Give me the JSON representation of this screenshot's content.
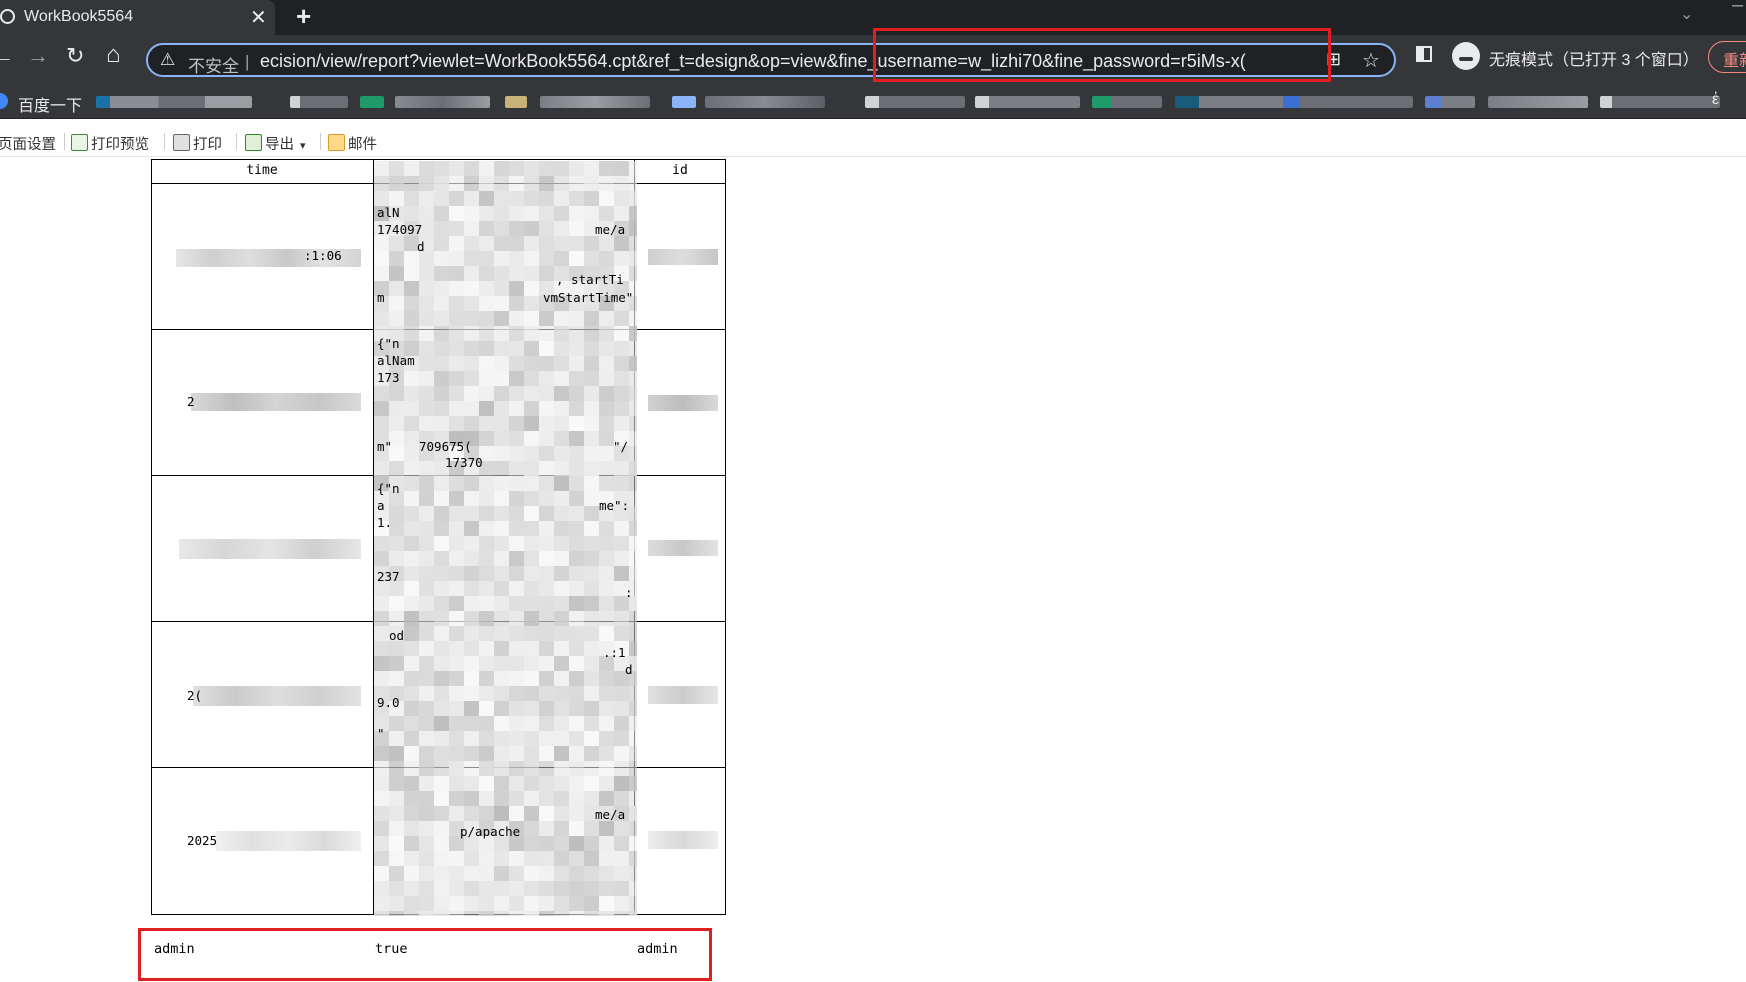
{
  "browser": {
    "tab_title": "WorkBook5564",
    "tab_close_glyph": "✕",
    "new_tab_glyph": "+",
    "tab_menu_glyph": "⌄",
    "minimize_glyph": "–",
    "nav_back_glyph": "←",
    "nav_forward_glyph": "→",
    "reload_glyph": "↻",
    "home_glyph": "⌂",
    "security_warning_glyph": "⚠",
    "security_label": "不安全",
    "security_separator": "|",
    "url": "ecision/view/report?viewlet=WorkBook5564.cpt&ref_t=design&op=view&fine_username=w_lizhi70&fine_password=r5iMs-x(",
    "qr_glyph": "⊞",
    "star_glyph": "☆",
    "incognito_label": "无痕模式（已打开 3 个窗口）",
    "restart_label": "重新"
  },
  "bookmarks": {
    "first_label": "百度一下",
    "trailing_glyph": "ἑ"
  },
  "report_toolbar": {
    "items": [
      {
        "label": "页面设置",
        "icon": "page-setup-icon"
      },
      {
        "label": "打印预览",
        "icon": "print-preview-icon"
      },
      {
        "label": "打印",
        "icon": "printer-icon"
      },
      {
        "label": "导出",
        "icon": "export-icon",
        "dropdown": "▾"
      },
      {
        "label": "邮件",
        "icon": "mail-icon"
      }
    ]
  },
  "report": {
    "columns": [
      "time",
      "",
      "id"
    ],
    "rows": [
      {
        "time": ":1:06",
        "fragments": [
          "alN",
          "174097",
          "d",
          "me/a",
          ", startTi",
          "m",
          "vmStartTime\""
        ]
      },
      {
        "time": "2",
        "fragments": [
          "{\"n",
          "alNam",
          "173",
          "m\"",
          "709675(",
          "\"/",
          "17370"
        ]
      },
      {
        "time": "",
        "fragments": [
          "{\"n",
          "a",
          "1.",
          "me\":",
          "237",
          ":"
        ]
      },
      {
        "time": "2(",
        "fragments": [
          "od",
          ".:1",
          "9.0",
          "d",
          "\""
        ]
      },
      {
        "time": "2025",
        "fragments": [
          "me/a",
          "p/apache"
        ]
      }
    ],
    "extra_row": {
      "col1": "admin",
      "col2": "true",
      "col3": "admin"
    }
  }
}
